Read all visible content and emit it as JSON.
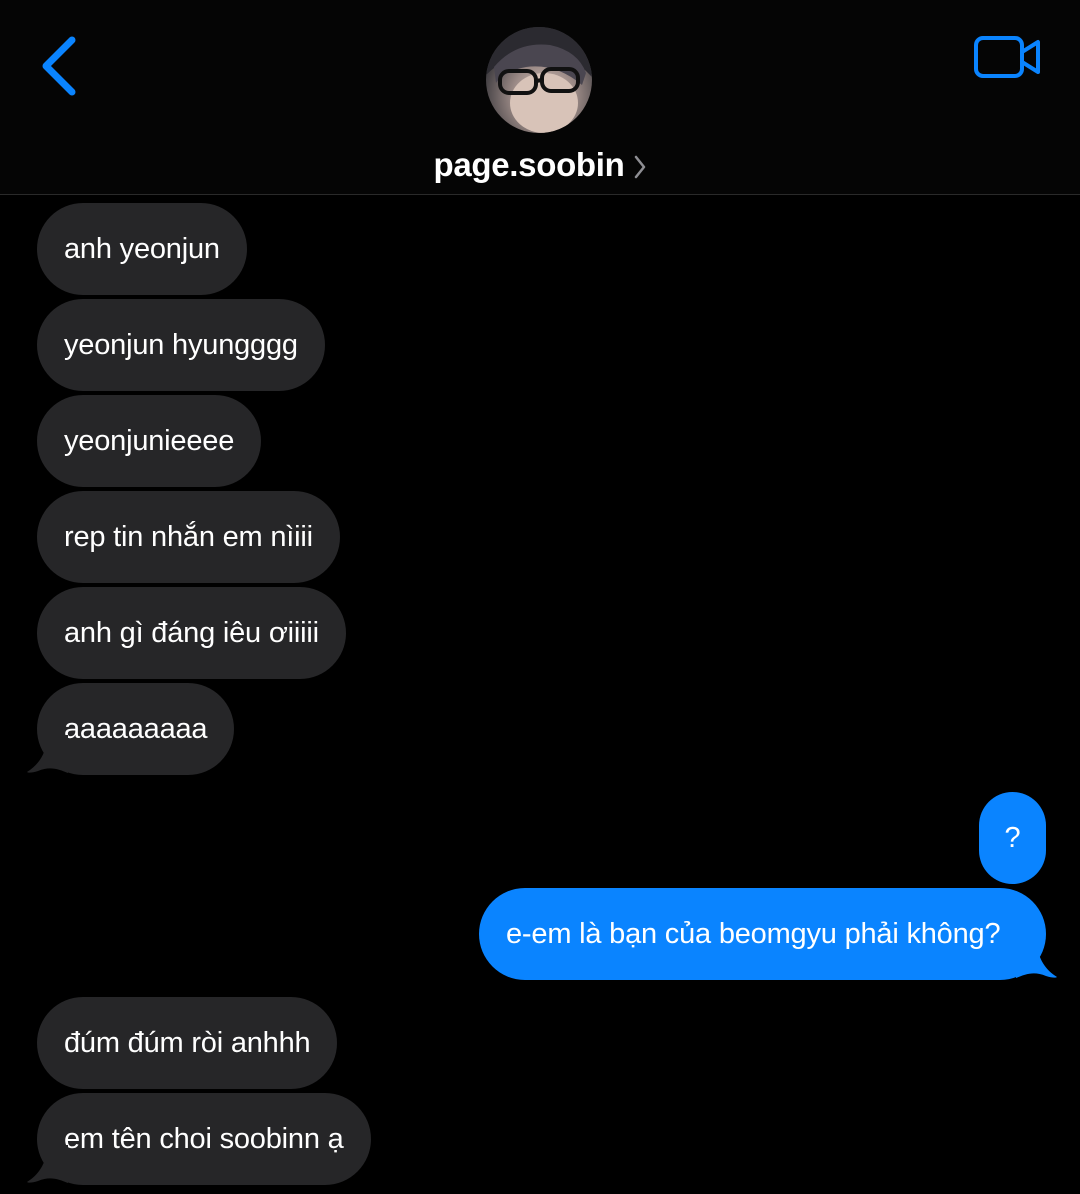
{
  "header": {
    "contact_name": "page.soobin",
    "back_icon": "chevron-left-icon",
    "video_icon": "video-camera-icon",
    "info_icon": "chevron-right-icon",
    "accent_color": "#0a84ff"
  },
  "messages": [
    {
      "from": "them",
      "text": "anh yeonjun"
    },
    {
      "from": "them",
      "text": "yeonjun hyungggg"
    },
    {
      "from": "them",
      "text": "yeonjunieeee"
    },
    {
      "from": "them",
      "text": "rep tin nhắn em nìiii"
    },
    {
      "from": "them",
      "text": "anh gì đáng iêu ơiiiii"
    },
    {
      "from": "them",
      "text": "aaaaaaaaa"
    },
    {
      "from": "me",
      "text": "?"
    },
    {
      "from": "me",
      "text": "e-em là bạn của beomgyu phải không?"
    },
    {
      "from": "them",
      "text": "đúm đúm ròi anhhh"
    },
    {
      "from": "them",
      "text": "em tên choi soobinn ạ"
    }
  ],
  "colors": {
    "background": "#000000",
    "incoming_bubble": "#262628",
    "outgoing_bubble": "#0a84ff"
  }
}
